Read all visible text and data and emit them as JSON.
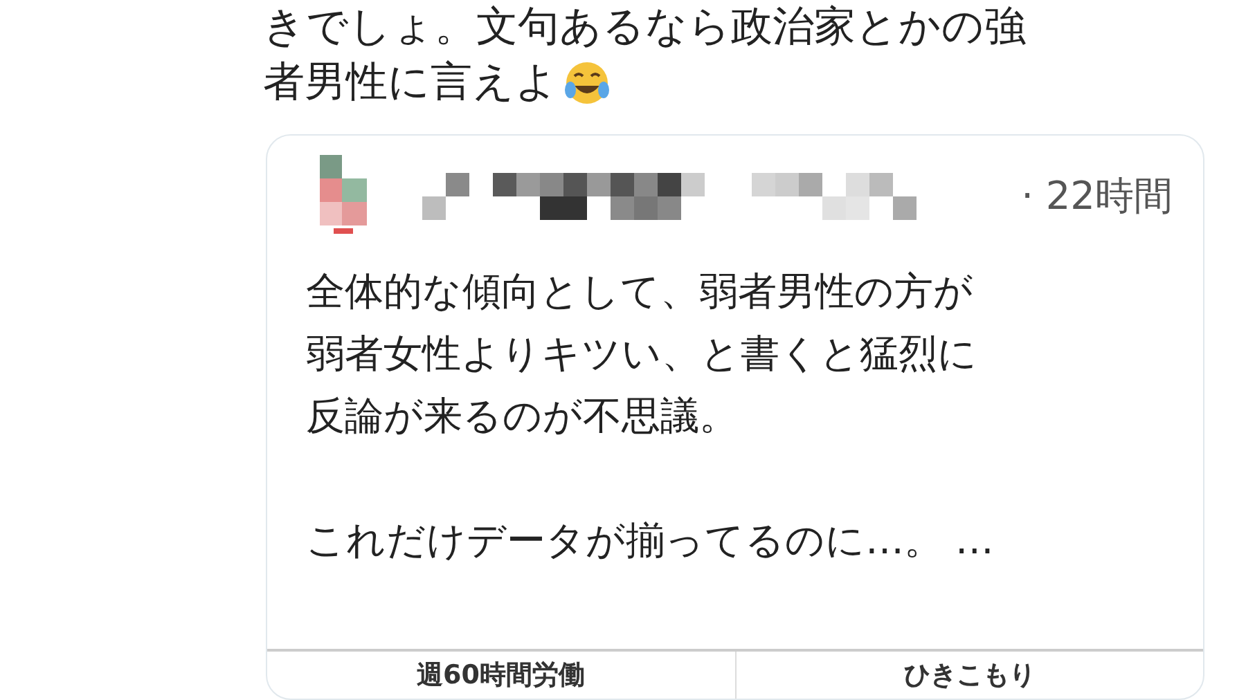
{
  "tweet": {
    "lines": [
      "きでしょ。文句あるなら政治家とかの強",
      "者男性に言えよ"
    ]
  },
  "quote": {
    "time": "· 22時間",
    "lines": [
      "全体的な傾向として、弱者男性の方が",
      "弱者女性よりキツい、と書くと猛烈に",
      "反論が来るのが不思議。",
      "これだけデータが揃ってるのに…。 …"
    ],
    "table": {
      "columns": [
        "週60時間労働",
        "ひきこもり"
      ]
    }
  }
}
